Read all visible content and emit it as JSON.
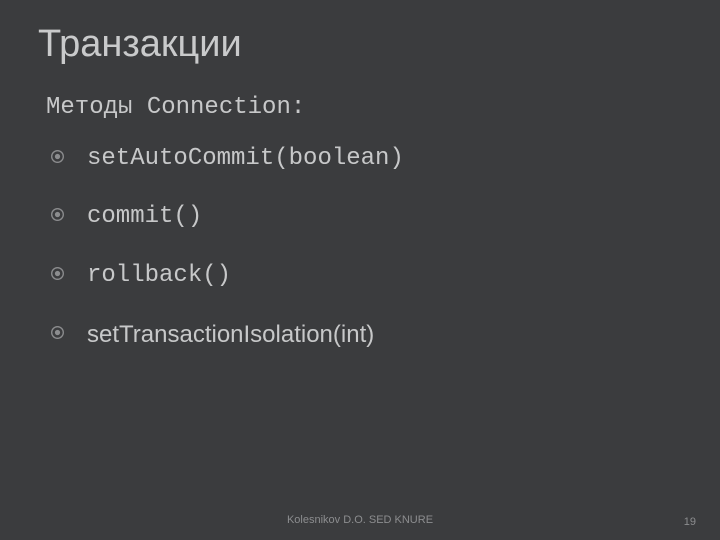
{
  "title": "Транзакции",
  "subtitle": "Методы Connection:",
  "bullets": [
    {
      "text": "setAutoCommit(boolean)",
      "font": "mono"
    },
    {
      "text": "commit()",
      "font": "mono"
    },
    {
      "text": "rollback()",
      "font": "mono"
    },
    {
      "text": "setTransactionIsolation(int)",
      "font": "sans"
    }
  ],
  "footer": "Kolesnikov D.O. SED KNURE",
  "page_number": "19",
  "colors": {
    "background": "#3b3c3e",
    "text": "#c7c8c9",
    "muted": "#8c8d8f",
    "bullet": "#8c8d8f"
  }
}
